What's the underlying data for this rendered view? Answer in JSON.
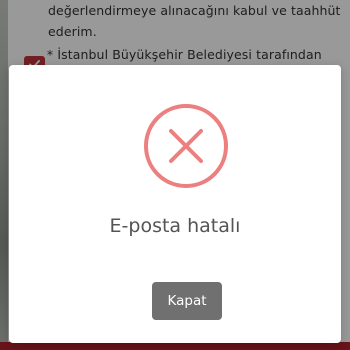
{
  "background": {
    "consent_line1": "değerlendirmeye alınacağını kabul ve taahhüt",
    "consent_line2": "ederim.",
    "consent_line3": "* İstanbul Büyükşehir Belediyesi tarafından Kişisel",
    "checkbox_checked": true,
    "accent_color": "#c0343b"
  },
  "modal": {
    "icon": "error-x-circle-icon",
    "icon_color": "#ec7f7f",
    "message": "E-posta hatalı",
    "close_label": "Kapat"
  }
}
